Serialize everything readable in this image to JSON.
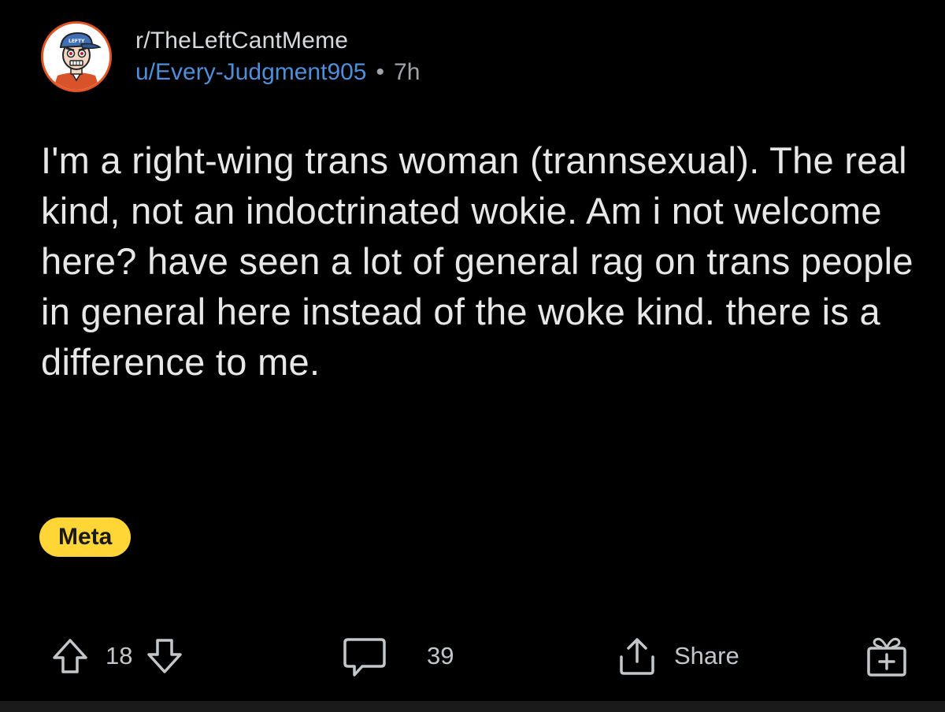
{
  "header": {
    "subreddit": "r/TheLeftCantMeme",
    "author": "u/Every-Judgment905",
    "separator": "•",
    "age": "7h",
    "avatar_icon": "cartoon-avatar-icon",
    "avatar_cap_text": "LEFTY"
  },
  "post": {
    "title": "I'm a right-wing trans woman (trannsexual). The real kind, not an indoctrinated wokie. Am i not welcome here? have seen a lot of general rag on trans people in general here instead of the woke kind. there is a difference to me.",
    "flair": "Meta"
  },
  "actions": {
    "upvote_icon": "arrow-up-icon",
    "vote_count": "18",
    "downvote_icon": "arrow-down-icon",
    "comment_icon": "comment-bubble-icon",
    "comment_count": "39",
    "share_icon": "share-icon",
    "share_label": "Share",
    "award_icon": "gift-award-icon"
  },
  "colors": {
    "background": "#000000",
    "author_link": "#4f8fd9",
    "flair_bg": "#ffd635",
    "text": "#e7e7e7"
  }
}
